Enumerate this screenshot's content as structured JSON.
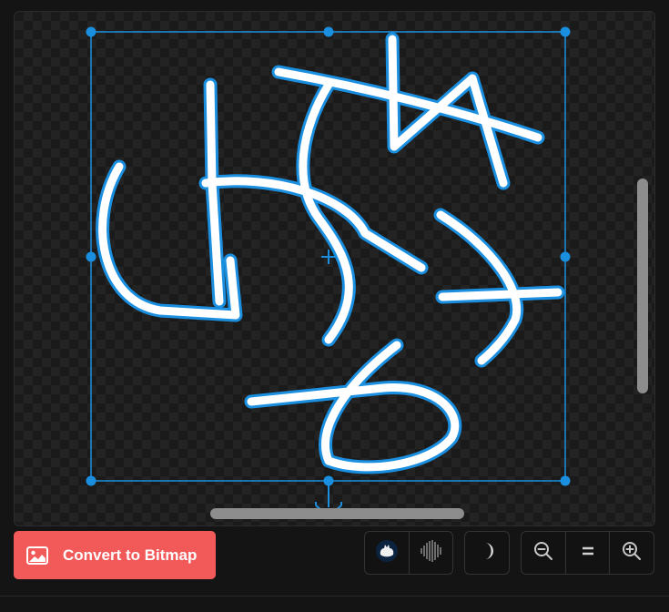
{
  "toolbar": {
    "convert_label": "Convert to Bitmap",
    "convert_icon": "image-icon",
    "convert_color": "#f25a5a",
    "modes": [
      "blob-icon",
      "waveform-icon"
    ],
    "theme_icon": "moon-icon",
    "zoom": [
      "zoom-out-icon",
      "fit-icon",
      "zoom-in-icon"
    ]
  },
  "canvas": {
    "background": "checkerboard",
    "selection_color": "#1a8fe0",
    "stroke_color": "#ffffff",
    "stroke_outline": "#1a8fe0"
  }
}
